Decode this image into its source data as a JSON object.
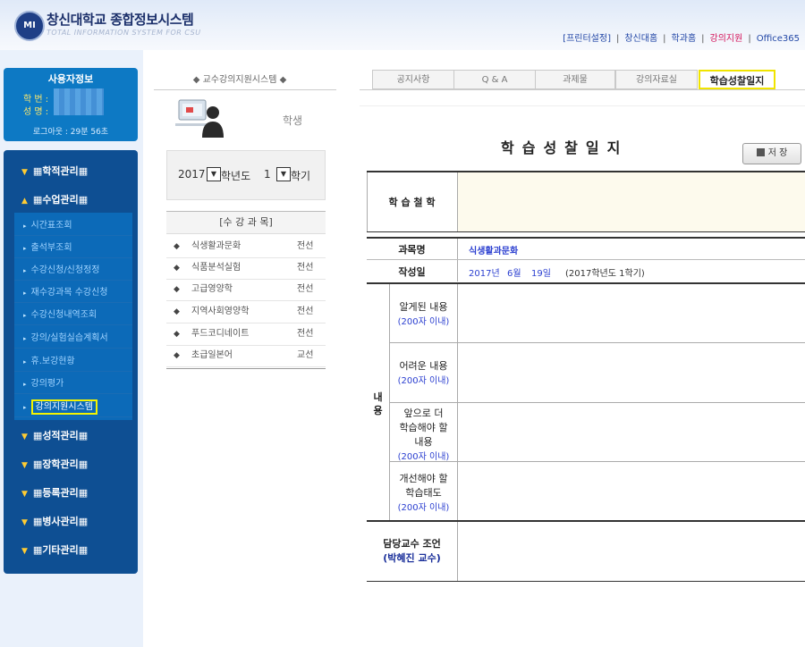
{
  "header": {
    "logo_text": "MI",
    "title": "창신대학교 종합정보시스템",
    "subtitle": "TOTAL INFORMATION SYSTEM FOR CSU",
    "links": [
      "[프린터설정]",
      "창신대홈",
      "학과홈",
      "강의지원",
      "Office365"
    ],
    "separator": "|"
  },
  "userbox": {
    "title": "사용자정보",
    "student_no_label": "학 번 :",
    "name_label": "성 명 :",
    "logout": "로그아웃 : 29분 56초"
  },
  "menu": {
    "sections": [
      {
        "label": "▦학적관리▦",
        "arrow": "▼"
      },
      {
        "label": "▦수업관리▦",
        "arrow": "▲"
      },
      {
        "label": "▦성적관리▦",
        "arrow": "▼"
      },
      {
        "label": "▦장학관리▦",
        "arrow": "▼"
      },
      {
        "label": "▦등록관리▦",
        "arrow": "▼"
      },
      {
        "label": "▦병사관리▦",
        "arrow": "▼"
      },
      {
        "label": "▦기타관리▦",
        "arrow": "▼"
      }
    ],
    "sub_items": [
      "시간표조회",
      "출석부조회",
      "수강신청/신청정정",
      "재수강과목 수강신청",
      "수강신청내역조회",
      "강의/실험실습계획서",
      "휴.보강현황",
      "강의평가",
      "강의지원시스템"
    ]
  },
  "middle": {
    "title": "◆ 교수강의지원시스템 ◆",
    "role": "학생",
    "year": "2017",
    "year_suffix": "학년도",
    "semester": "1",
    "semester_suffix": "학기",
    "dropdown_glyph": "▼",
    "course_header": "[수 강 과 목]",
    "bullet": "◆",
    "courses": [
      {
        "name": "식생활과문화",
        "type": "전선"
      },
      {
        "name": "식품분석실험",
        "type": "전선"
      },
      {
        "name": "고급영양학",
        "type": "전선"
      },
      {
        "name": "지역사회영양학",
        "type": "전선"
      },
      {
        "name": "푸드코디네이트",
        "type": "전선"
      },
      {
        "name": "초급일본어",
        "type": "교선"
      }
    ]
  },
  "tabs": [
    "공지사항",
    "Q & A",
    "과제물",
    "강의자료실",
    "학습성찰일지"
  ],
  "journal": {
    "title": "학습성찰일지",
    "save_label": "저 장",
    "philosophy_label": "학 습 철 학",
    "course_label": "과목명",
    "course_value": "식생활과문화",
    "date_label": "작성일",
    "date_year": "2017년",
    "date_month": "6월",
    "date_day": "19일",
    "date_term": "(2017학년도 1학기)",
    "content_label_1": "내",
    "content_label_2": "용",
    "learned_label": "알게된 내용",
    "difficult_label": "어려운 내용",
    "more_label_1": "앞으로 더",
    "more_label_2": "학습해야 할",
    "more_label_3": "내용",
    "improve_label_1": "개선해야 할",
    "improve_label_2": "학습태도",
    "limit": "(200자 이내)",
    "advice_label": "담당교수 조언",
    "advice_professor": "(박혜진 교수)"
  }
}
